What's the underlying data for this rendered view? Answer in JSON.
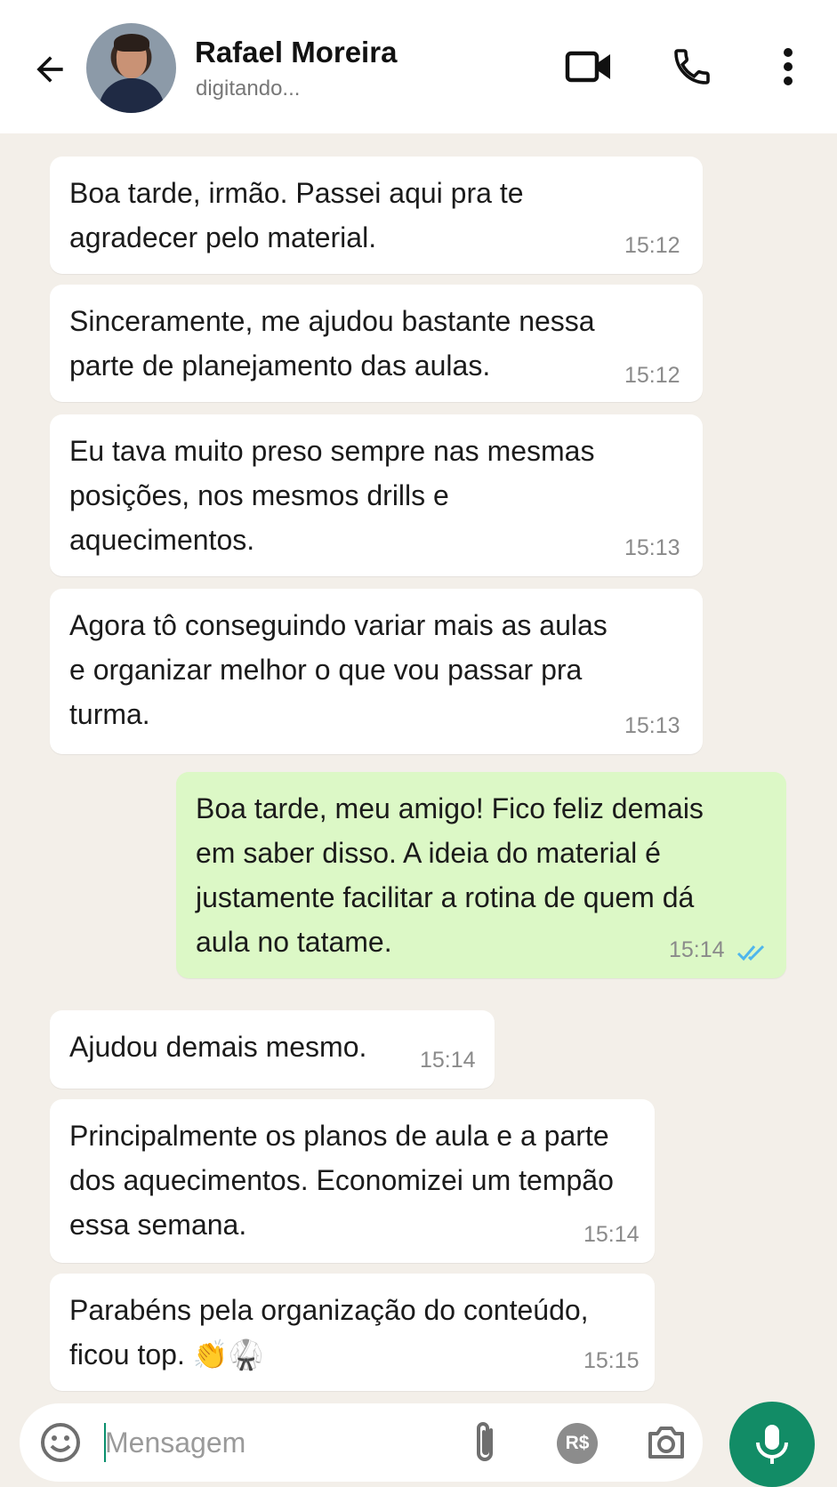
{
  "header": {
    "contact_name": "Rafael Moreira",
    "status": "digitando..."
  },
  "messages": [
    {
      "direction": "in",
      "text": "Boa tarde, irmão. Passei aqui pra te\nagradecer pelo material.",
      "time": "15:12"
    },
    {
      "direction": "in",
      "text": "Sinceramente, me ajudou bastante nessa\nparte de planejamento das aulas.",
      "time": "15:12"
    },
    {
      "direction": "in",
      "text": "Eu tava muito preso sempre nas mesmas\nposições, nos mesmos drills e\naquecimentos.",
      "time": "15:13"
    },
    {
      "direction": "in",
      "text": "Agora tô conseguindo variar mais as aulas\ne organizar melhor o que vou passar pra\nturma.",
      "time": "15:13"
    },
    {
      "direction": "out",
      "text": "Boa tarde, meu amigo! Fico feliz demais\nem saber disso. A ideia do material é\njustamente facilitar a rotina de quem dá\naula no tatame.",
      "time": "15:14",
      "status": "read"
    },
    {
      "direction": "in",
      "text": "Ajudou demais mesmo.",
      "time": "15:14"
    },
    {
      "direction": "in",
      "text": "Principalmente os planos de aula e a parte\ndos aquecimentos. Economizei um tempão\nessa semana.",
      "time": "15:14"
    },
    {
      "direction": "in",
      "text": "Parabéns pela organização do conteúdo,\nficou top. 👏🥋",
      "time": "15:15"
    }
  ],
  "composer": {
    "placeholder": "Mensagem",
    "pay_label": "R$"
  },
  "colors": {
    "accent": "#128c66",
    "outgoing_bubble": "#dcf8c6",
    "incoming_bubble": "#ffffff",
    "chat_background": "#f3efe9",
    "read_ticks": "#4fb6ec"
  },
  "icons": [
    "back-arrow-icon",
    "video-call-icon",
    "phone-icon",
    "more-vert-icon",
    "emoji-icon",
    "attach-icon",
    "camera-icon",
    "mic-icon"
  ]
}
